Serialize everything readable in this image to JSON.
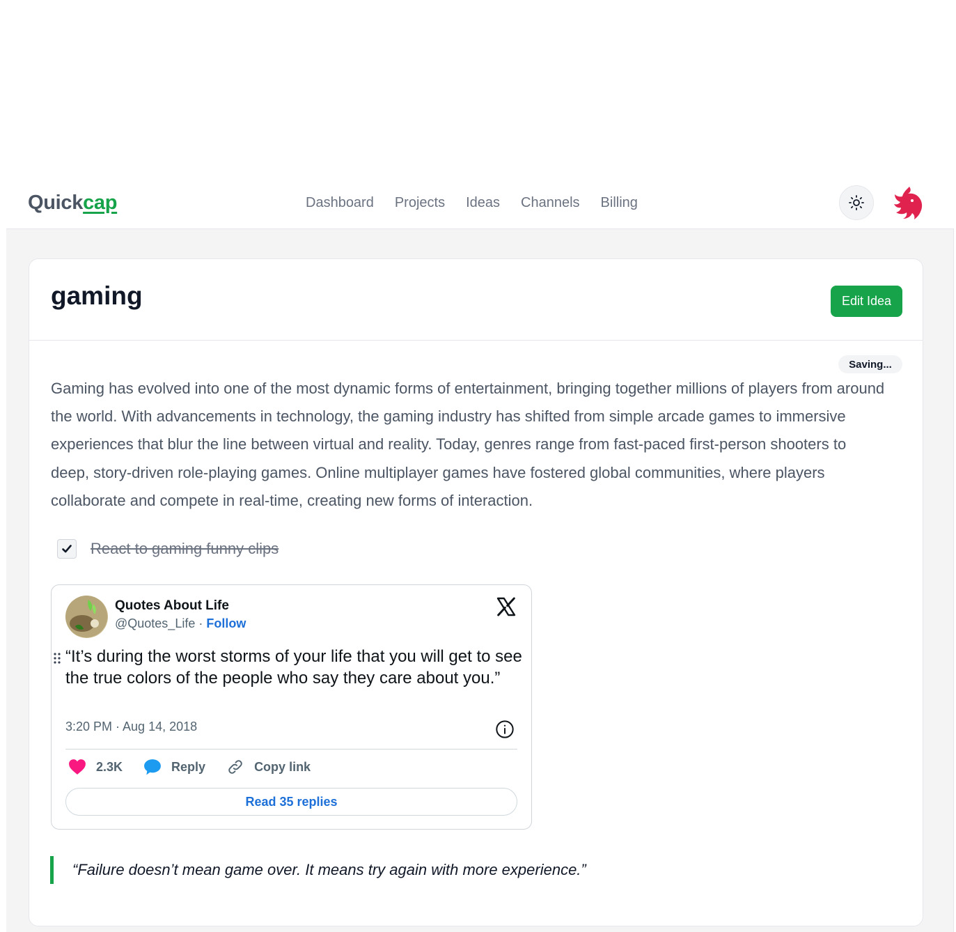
{
  "header": {
    "logo_main": "Quick",
    "logo_accent": "cap",
    "nav": [
      "Dashboard",
      "Projects",
      "Ideas",
      "Channels",
      "Billing"
    ],
    "theme_icon": "sun-icon",
    "brand_icon": "nestjs-cat-icon"
  },
  "idea": {
    "title": "gaming",
    "edit_label": "Edit Idea",
    "status": "Saving...",
    "body": "Gaming has evolved into one of the most dynamic forms of entertainment, bringing together millions of players from around the world. With advancements in technology, the gaming industry has shifted from simple arcade games to immersive experiences that blur the line between virtual and reality. Today, genres range from fast-paced first-person shooters to deep, story-driven role-playing games. Online multiplayer games have fostered global communities, where players collaborate and compete in real-time, creating new forms of interaction.",
    "todo": {
      "label": "React to gaming funny clips",
      "checked": true
    },
    "tweet": {
      "author": "Quotes About Life",
      "handle": "@Quotes_Life",
      "separator": "·",
      "follow": "Follow",
      "text": "“It’s during the worst storms of your life that you will get to see the  true colors of the people who say they care about you.”",
      "time": "3:20 PM · Aug 14, 2018",
      "likes": "2.3K",
      "reply": "Reply",
      "copy": "Copy link",
      "read_replies": "Read 35 replies"
    },
    "quote": "“Failure doesn’t mean game over. It means try again with more experience.”"
  },
  "colors": {
    "brand_green": "#16a34a",
    "link_blue": "#1d70d8",
    "like_pink": "#f91880",
    "reply_blue": "#1d9bf0",
    "logo_red": "#e0234e"
  }
}
